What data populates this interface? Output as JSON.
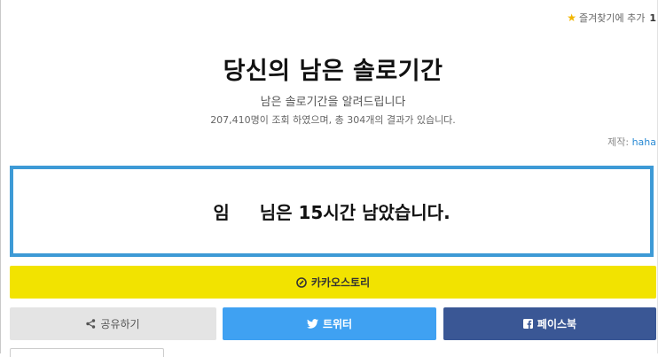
{
  "favorite": {
    "label": "즐겨찾기에 추가",
    "count": "1"
  },
  "title": "당신의 남은 솔로기간",
  "subtitle": "남은 솔로기간을 알려드립니다",
  "stats": "207,410명이 조회 하였으며, 총 304개의 결과가 있습니다.",
  "maker": {
    "label": "제작:",
    "author": "haha"
  },
  "result": {
    "name": "임",
    "text": "님은 15시간 남았습니다."
  },
  "buttons": {
    "kakao": "카카오스토리",
    "share": "공유하기",
    "twitter": "트위터",
    "facebook": "페이스북"
  },
  "colors": {
    "kakao": "#f2e300",
    "twitter": "#3fa1f2",
    "facebook": "#3a5795",
    "share": "#e4e4e4",
    "result_border": "#3d9ad6",
    "favorite_star": "#f2b600",
    "author_link": "#2a8ad4"
  },
  "icons": {
    "favorite": "star-icon",
    "kakao": "kakaostory-icon",
    "share": "share-icon",
    "twitter": "twitter-bird-icon",
    "facebook": "facebook-f-icon"
  }
}
